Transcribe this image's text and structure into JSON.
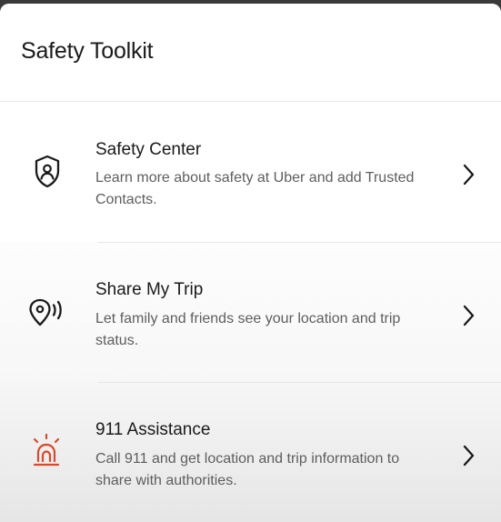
{
  "sheet": {
    "title": "Safety Toolkit"
  },
  "items": [
    {
      "icon": "shield-icon",
      "title": "Safety Center",
      "description": "Learn more about safety at Uber and add Trusted Contacts."
    },
    {
      "icon": "share-location-icon",
      "title": "Share My Trip",
      "description": "Let family and friends see your location and trip status."
    },
    {
      "icon": "emergency-siren-icon",
      "title": "911 Assistance",
      "description": "Call 911 and get location and trip information to share with authorities."
    }
  ],
  "colors": {
    "emergency_accent": "#d9492b",
    "text_primary": "#1a1a1a",
    "text_secondary": "#5e5e5e"
  }
}
